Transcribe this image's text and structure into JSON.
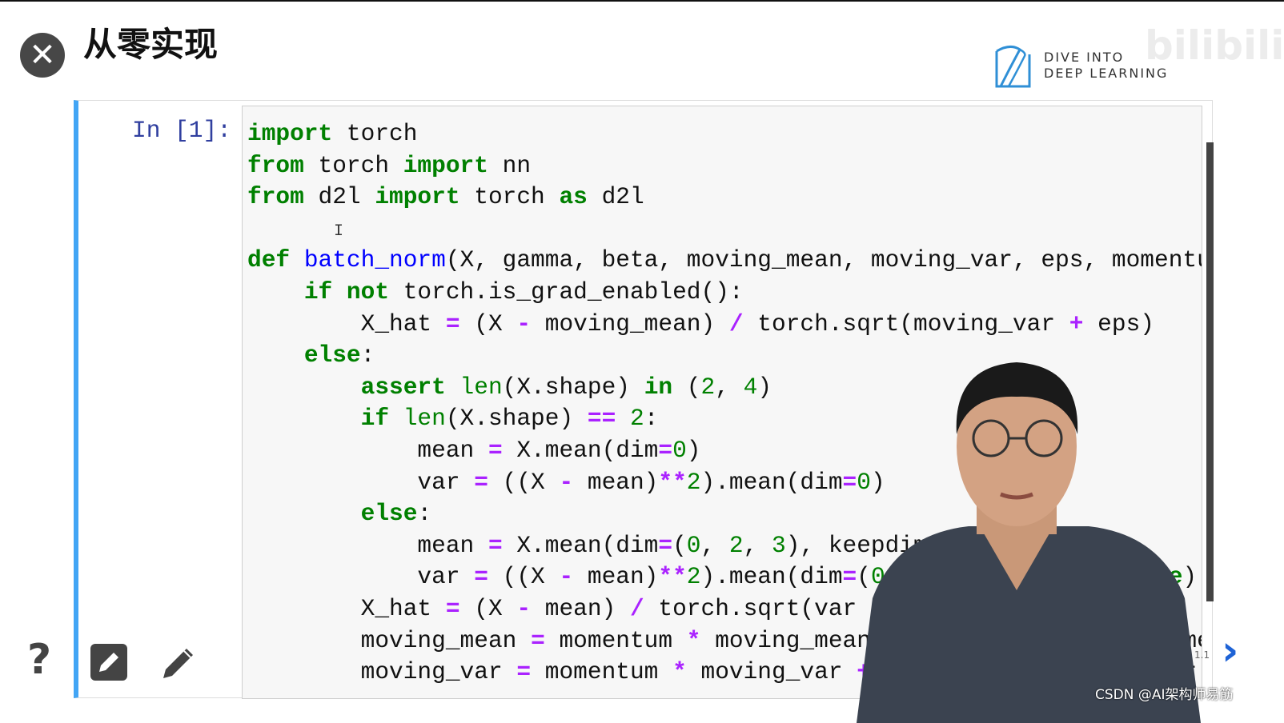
{
  "slide": {
    "title": "从零实现",
    "slide_number": "1.1"
  },
  "logo": {
    "line1": "DIVE INTO",
    "line2": "DEEP LEARNING",
    "watermark": "bilibili"
  },
  "cell": {
    "prompt": "In [1]:"
  },
  "code_lines": [
    [
      [
        "k",
        "import"
      ],
      [
        "t",
        " torch"
      ]
    ],
    [
      [
        "k",
        "from"
      ],
      [
        "t",
        " torch "
      ],
      [
        "k",
        "import"
      ],
      [
        "t",
        " nn"
      ]
    ],
    [
      [
        "k",
        "from"
      ],
      [
        "t",
        " d2l "
      ],
      [
        "k",
        "import"
      ],
      [
        "t",
        " torch "
      ],
      [
        "k",
        "as"
      ],
      [
        "t",
        " d2l"
      ]
    ],
    [
      [
        "t",
        ""
      ]
    ],
    [
      [
        "k",
        "def"
      ],
      [
        "t",
        " "
      ],
      [
        "f",
        "batch_norm"
      ],
      [
        "t",
        "(X, gamma, beta, moving_mean, moving_var, eps, momentum):"
      ]
    ],
    [
      [
        "t",
        "    "
      ],
      [
        "k",
        "if"
      ],
      [
        "t",
        " "
      ],
      [
        "k",
        "not"
      ],
      [
        "t",
        " torch.is_grad_enabled():"
      ]
    ],
    [
      [
        "t",
        "        X_hat "
      ],
      [
        "o",
        "="
      ],
      [
        "t",
        " (X "
      ],
      [
        "o",
        "-"
      ],
      [
        "t",
        " moving_mean) "
      ],
      [
        "o",
        "/"
      ],
      [
        "t",
        " torch.sqrt(moving_var "
      ],
      [
        "o",
        "+"
      ],
      [
        "t",
        " eps)"
      ]
    ],
    [
      [
        "t",
        "    "
      ],
      [
        "k",
        "else"
      ],
      [
        "t",
        ":"
      ]
    ],
    [
      [
        "t",
        "        "
      ],
      [
        "k",
        "assert"
      ],
      [
        "t",
        " "
      ],
      [
        "b",
        "len"
      ],
      [
        "t",
        "(X.shape) "
      ],
      [
        "k",
        "in"
      ],
      [
        "t",
        " ("
      ],
      [
        "n",
        "2"
      ],
      [
        "t",
        ", "
      ],
      [
        "n",
        "4"
      ],
      [
        "t",
        ")"
      ]
    ],
    [
      [
        "t",
        "        "
      ],
      [
        "k",
        "if"
      ],
      [
        "t",
        " "
      ],
      [
        "b",
        "len"
      ],
      [
        "t",
        "(X.shape) "
      ],
      [
        "o",
        "=="
      ],
      [
        "t",
        " "
      ],
      [
        "n",
        "2"
      ],
      [
        "t",
        ":"
      ]
    ],
    [
      [
        "t",
        "            mean "
      ],
      [
        "o",
        "="
      ],
      [
        "t",
        " X.mean(dim"
      ],
      [
        "o",
        "="
      ],
      [
        "n",
        "0"
      ],
      [
        "t",
        ")"
      ]
    ],
    [
      [
        "t",
        "            var "
      ],
      [
        "o",
        "="
      ],
      [
        "t",
        " ((X "
      ],
      [
        "o",
        "-"
      ],
      [
        "t",
        " mean)"
      ],
      [
        "o",
        "**"
      ],
      [
        "n",
        "2"
      ],
      [
        "t",
        ").mean(dim"
      ],
      [
        "o",
        "="
      ],
      [
        "n",
        "0"
      ],
      [
        "t",
        ")"
      ]
    ],
    [
      [
        "t",
        "        "
      ],
      [
        "k",
        "else"
      ],
      [
        "t",
        ":"
      ]
    ],
    [
      [
        "t",
        "            mean "
      ],
      [
        "o",
        "="
      ],
      [
        "t",
        " X.mean(dim"
      ],
      [
        "o",
        "="
      ],
      [
        "t",
        "("
      ],
      [
        "n",
        "0"
      ],
      [
        "t",
        ", "
      ],
      [
        "n",
        "2"
      ],
      [
        "t",
        ", "
      ],
      [
        "n",
        "3"
      ],
      [
        "t",
        "), keepdim"
      ],
      [
        "o",
        "="
      ],
      [
        "k",
        "True"
      ],
      [
        "t",
        ")"
      ]
    ],
    [
      [
        "t",
        "            var "
      ],
      [
        "o",
        "="
      ],
      [
        "t",
        " ((X "
      ],
      [
        "o",
        "-"
      ],
      [
        "t",
        " mean)"
      ],
      [
        "o",
        "**"
      ],
      [
        "n",
        "2"
      ],
      [
        "t",
        ").mean(dim"
      ],
      [
        "o",
        "="
      ],
      [
        "t",
        "("
      ],
      [
        "n",
        "0"
      ],
      [
        "t",
        ", "
      ],
      [
        "n",
        "2"
      ],
      [
        "t",
        ", "
      ],
      [
        "n",
        "3"
      ],
      [
        "t",
        "), keepdim"
      ],
      [
        "o",
        "="
      ],
      [
        "k",
        "True"
      ],
      [
        "t",
        ")"
      ]
    ],
    [
      [
        "t",
        "        X_hat "
      ],
      [
        "o",
        "="
      ],
      [
        "t",
        " (X "
      ],
      [
        "o",
        "-"
      ],
      [
        "t",
        " mean) "
      ],
      [
        "o",
        "/"
      ],
      [
        "t",
        " torch.sqrt(var "
      ],
      [
        "o",
        "+"
      ],
      [
        "t",
        " eps)"
      ]
    ],
    [
      [
        "t",
        "        moving_mean "
      ],
      [
        "o",
        "="
      ],
      [
        "t",
        " momentum "
      ],
      [
        "o",
        "*"
      ],
      [
        "t",
        " moving_mean "
      ],
      [
        "o",
        "+"
      ],
      [
        "t",
        " ("
      ],
      [
        "n",
        "1.0"
      ],
      [
        "t",
        " "
      ],
      [
        "o",
        "-"
      ],
      [
        "t",
        " momentum) "
      ],
      [
        "o",
        "*"
      ],
      [
        "t",
        " mean"
      ]
    ],
    [
      [
        "t",
        "        moving_var "
      ],
      [
        "o",
        "="
      ],
      [
        "t",
        " momentum "
      ],
      [
        "o",
        "*"
      ],
      [
        "t",
        " moving_var "
      ],
      [
        "o",
        "+"
      ],
      [
        "t",
        " ("
      ],
      [
        "n",
        "1.0"
      ],
      [
        "t",
        " "
      ],
      [
        "o",
        "-"
      ],
      [
        "t",
        " momentum) "
      ],
      [
        "o",
        "*"
      ],
      [
        "t",
        " var"
      ]
    ]
  ],
  "footer": {
    "watermark": "CSDN @AI架构师易筋"
  },
  "colors": {
    "keyword": "#008000",
    "function": "#0000ff",
    "operator": "#aa22ff",
    "cell_border": "#42a5f5",
    "next_arrow": "#1e63d6"
  },
  "icons": [
    "close-icon",
    "help-icon",
    "edit-square-icon",
    "pencil-icon",
    "chevron-right-icon"
  ]
}
